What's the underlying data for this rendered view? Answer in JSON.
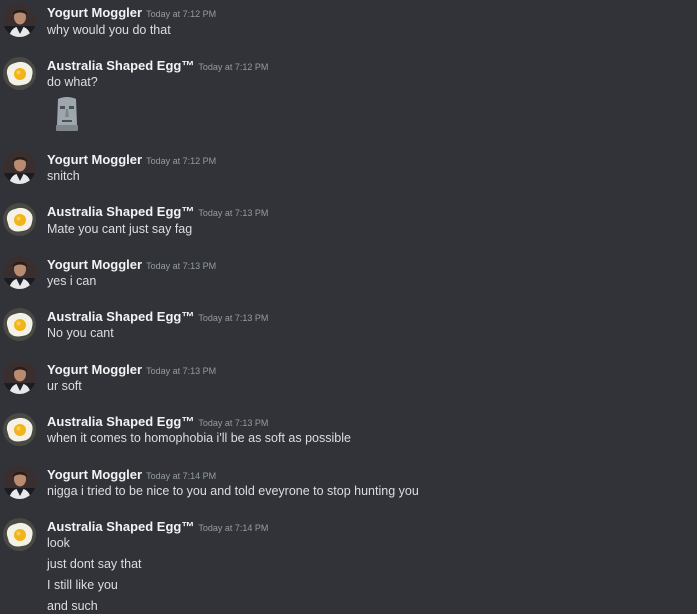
{
  "messages": [
    {
      "author": "Yogurt Moggler",
      "avatar": "man-portrait-avatar",
      "timestamp": "Today at 7:12 PM",
      "lines": [
        "why would you do that"
      ]
    },
    {
      "author": "Australia Shaped Egg™",
      "avatar": "fried-egg-avatar",
      "timestamp": "Today at 7:12 PM",
      "lines": [
        "do what?"
      ],
      "emoji": "moai-emoji"
    },
    {
      "author": "Yogurt Moggler",
      "avatar": "man-portrait-avatar",
      "timestamp": "Today at 7:12 PM",
      "lines": [
        "snitch"
      ]
    },
    {
      "author": "Australia Shaped Egg™",
      "avatar": "fried-egg-avatar",
      "timestamp": "Today at 7:13 PM",
      "lines": [
        "Mate you cant just say fag"
      ]
    },
    {
      "author": "Yogurt Moggler",
      "avatar": "man-portrait-avatar",
      "timestamp": "Today at 7:13 PM",
      "lines": [
        "yes i can"
      ]
    },
    {
      "author": "Australia Shaped Egg™",
      "avatar": "fried-egg-avatar",
      "timestamp": "Today at 7:13 PM",
      "lines": [
        "No you cant"
      ]
    },
    {
      "author": "Yogurt Moggler",
      "avatar": "man-portrait-avatar",
      "timestamp": "Today at 7:13 PM",
      "lines": [
        "ur soft"
      ]
    },
    {
      "author": "Australia Shaped Egg™",
      "avatar": "fried-egg-avatar",
      "timestamp": "Today at 7:13 PM",
      "lines": [
        "when it comes to homophobia i'll be as soft as possible"
      ]
    },
    {
      "author": "Yogurt Moggler",
      "avatar": "man-portrait-avatar",
      "timestamp": "Today at 7:14 PM",
      "lines": [
        "nigga i tried to be nice to you and told eveyrone to stop hunting you"
      ]
    },
    {
      "author": "Australia Shaped Egg™",
      "avatar": "fried-egg-avatar",
      "timestamp": "Today at 7:14 PM",
      "lines": [
        "look",
        "just dont say that",
        "I still like you",
        "and such"
      ]
    }
  ],
  "colors": {
    "background": "#313338",
    "username": "#f2f3f5",
    "timestamp": "#949ba4",
    "text": "#dbdee1"
  }
}
